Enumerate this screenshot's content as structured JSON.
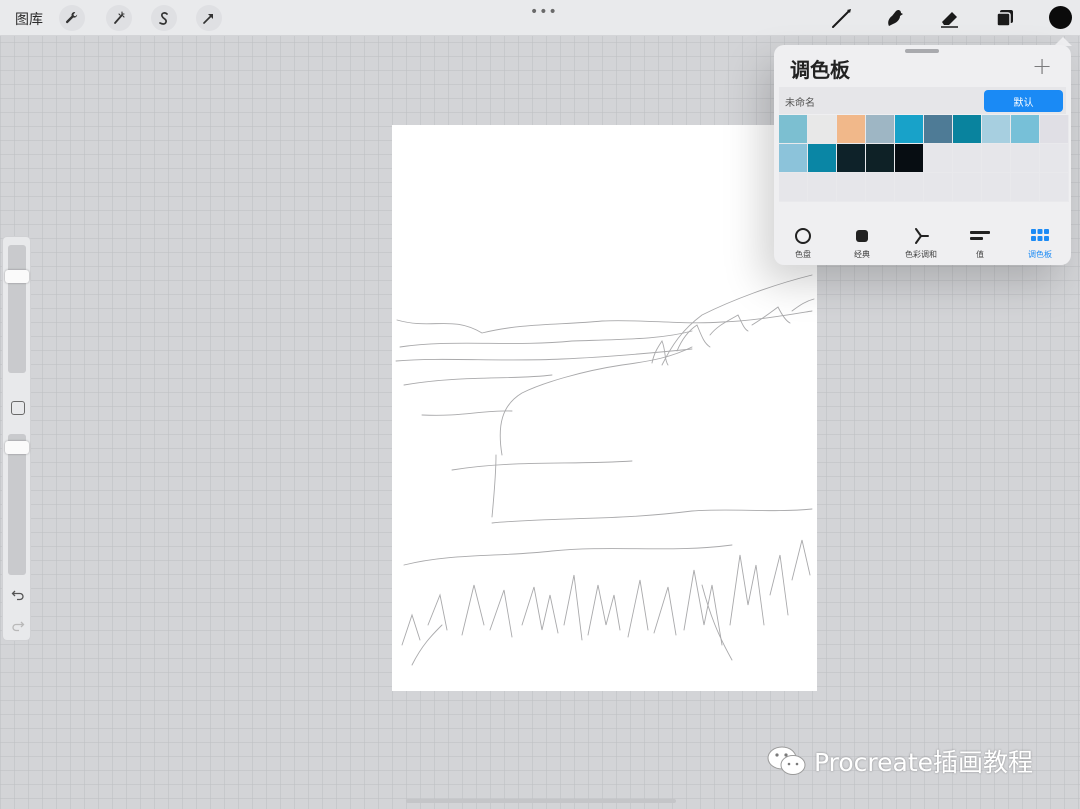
{
  "toolbar": {
    "gallery_label": "图库",
    "more_label": "•••",
    "left_tools": [
      {
        "name": "actions",
        "icon": "wrench-icon"
      },
      {
        "name": "adjustments",
        "icon": "magic-wand-icon"
      },
      {
        "name": "selection",
        "icon": "selection-s-icon"
      },
      {
        "name": "transform",
        "icon": "arrow-cursor-icon"
      }
    ],
    "right_tools": [
      {
        "name": "brush",
        "icon": "brush-icon"
      },
      {
        "name": "smudge",
        "icon": "smudge-icon"
      },
      {
        "name": "eraser",
        "icon": "eraser-icon"
      },
      {
        "name": "layers",
        "icon": "layers-icon"
      }
    ],
    "current_color": "#0b0b0b"
  },
  "sidebar": {
    "brush_size_level": 0.1,
    "opacity_level": 0.06,
    "undo_icon": "undo-icon",
    "redo_icon": "redo-icon"
  },
  "color_panel": {
    "title": "调色板",
    "add_icon": "plus-icon",
    "palette_name": "未命名",
    "default_label": "默认",
    "swatches": [
      "#7cbfd1",
      "#e8e8e8",
      "#f1b88a",
      "#9eb6c4",
      "#18a2c9",
      "#4e7b96",
      "#09839e",
      "#a7cfe0",
      "#77c0d8",
      "#e0dfe5",
      "#8cc3da",
      "#0a86a5",
      "#0e2229",
      "#0e2126",
      "#070d12",
      "#e6e6ea",
      "#e6e6ea",
      "#e6e6ea",
      "#e6e6ea",
      "#e6e6ea",
      "#e6e6ea",
      "#e6e6ea",
      "#e6e6ea",
      "#e6e6ea",
      "#e6e6ea",
      "#e6e6ea",
      "#e6e6ea",
      "#e6e6ea",
      "#e6e6ea",
      "#e6e6ea"
    ],
    "tabs": [
      {
        "label": "色盘",
        "icon": "disc-icon"
      },
      {
        "label": "经典",
        "icon": "square-icon"
      },
      {
        "label": "色彩调和",
        "icon": "harmony-icon"
      },
      {
        "label": "值",
        "icon": "sliders-icon"
      },
      {
        "label": "调色板",
        "icon": "grid-icon",
        "active": true
      }
    ],
    "accent": "#1a8af5"
  },
  "watermark": {
    "text": "Procreate插画教程"
  }
}
